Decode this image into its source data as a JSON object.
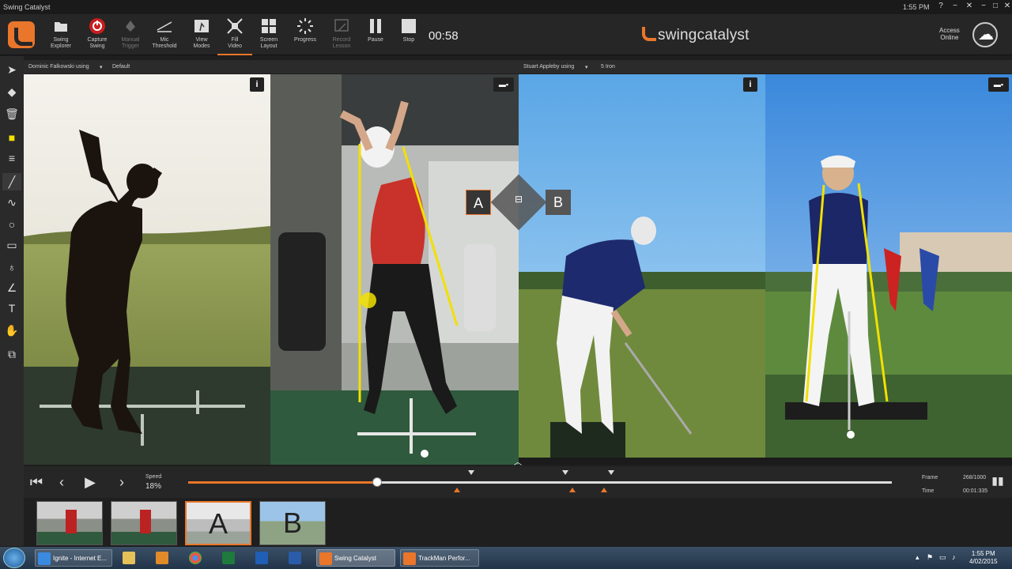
{
  "window": {
    "title": "Swing Catalyst",
    "clock": "1:55 PM",
    "controls": [
      "?",
      "−",
      "✕",
      "−",
      "□",
      "✕"
    ]
  },
  "toolbar": {
    "buttons": [
      {
        "label": "Swing\nExplorer",
        "icon": "folder-icon"
      },
      {
        "label": "Capture\nSwing",
        "icon": "record-icon"
      },
      {
        "label": "Manual\nTrigger",
        "icon": "trigger-icon"
      },
      {
        "label": "Mic\nThreshold",
        "icon": "mic-threshold-icon"
      },
      {
        "label": "View\nModes",
        "icon": "view-modes-icon"
      },
      {
        "label": "Fill\nVideo",
        "icon": "fill-video-icon"
      },
      {
        "label": "Screen\nLayout",
        "icon": "layout-icon"
      },
      {
        "label": "Progress",
        "icon": "progress-icon"
      },
      {
        "label": "Record\nLesson",
        "icon": "record-lesson-icon"
      },
      {
        "label": "Pause",
        "icon": "pause-icon"
      },
      {
        "label": "Stop",
        "icon": "stop-icon"
      }
    ],
    "timer": "00:58",
    "brand": "swingcatalyst",
    "access_label": "Access",
    "access_status": "Online",
    "accent_color": "#e9762b"
  },
  "video_a": {
    "player": "Dominic Falkowski using",
    "club": "Default",
    "badge": "A"
  },
  "video_b": {
    "player": "Stuart Appleby using",
    "club": "5 Iron",
    "badge": "B"
  },
  "tools": [
    "pointer-icon",
    "eraser-icon",
    "trash-icon",
    "marker-icon",
    "lines-icon",
    "line-icon",
    "curve-icon",
    "circle-icon",
    "rectangle-icon",
    "body-icon",
    "angle-icon",
    "text-icon",
    "hand-icon",
    "compare-icon"
  ],
  "timeline": {
    "speed_label": "Speed",
    "speed_value": "18%",
    "progress": 0.268,
    "frame_label": "Frame",
    "frame_value": "268/1000",
    "time_label": "Time",
    "time_value": "00:01:335",
    "markers_top": [
      0.402,
      0.536,
      0.601
    ],
    "markers_bottom": [
      0.382,
      0.546,
      0.591
    ]
  },
  "thumbnails": [
    {
      "label": ""
    },
    {
      "label": ""
    },
    {
      "label": "A"
    },
    {
      "label": "B"
    }
  ],
  "taskbar": {
    "items": [
      {
        "label": "Ignite - Internet E...",
        "icon": "ie-icon"
      },
      {
        "label": "",
        "icon": "explorer-icon"
      },
      {
        "label": "",
        "icon": "media-player-icon"
      },
      {
        "label": "",
        "icon": "chrome-icon"
      },
      {
        "label": "",
        "icon": "excel-icon"
      },
      {
        "label": "",
        "icon": "outlook-icon"
      },
      {
        "label": "",
        "icon": "word-icon"
      },
      {
        "label": "Swing Catalyst",
        "icon": "swing-catalyst-icon"
      },
      {
        "label": "TrackMan Perfor...",
        "icon": "trackman-icon"
      }
    ],
    "time": "1:55 PM",
    "date": "4/02/2015"
  }
}
